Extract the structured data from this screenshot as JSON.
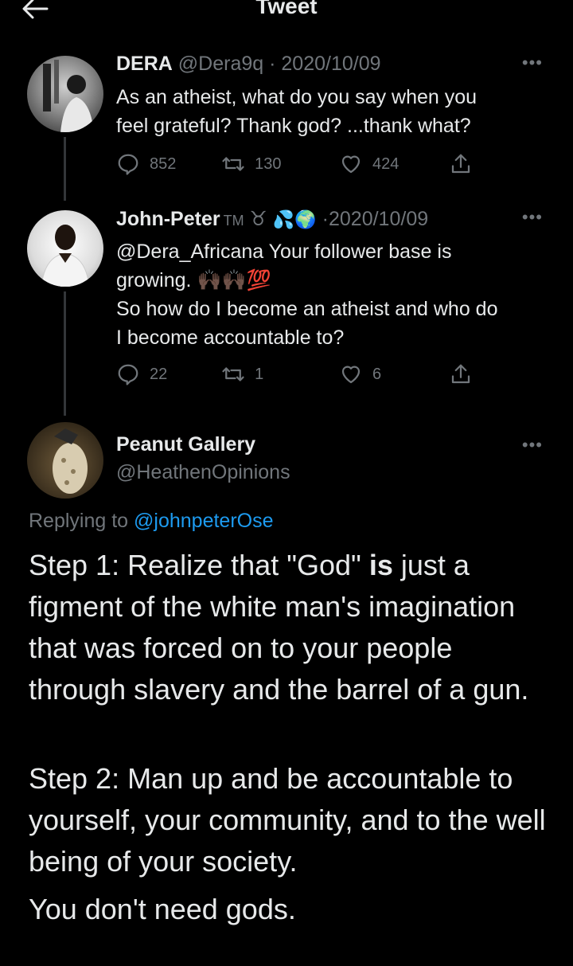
{
  "header": {
    "title": "Tweet"
  },
  "thread": [
    {
      "name": "DERA",
      "handle": "@Dera9q",
      "date": "2020/10/09",
      "sep": "·",
      "text_line1": "As an atheist, what do you say when you",
      "text_line2": "feel grateful? Thank god? ...thank what?",
      "replies": "852",
      "retweets": "130",
      "likes": "424"
    },
    {
      "name": "John-Peter",
      "badge": "TM",
      "symbol": "♉",
      "emojis": "💦🌍",
      "date": "2020/10/09",
      "sep": "·",
      "mention": "@Dera_Africana",
      "text_line1_rest": " Your follower base is",
      "text_line2": "growing. 🙌🏿🙌🏿💯",
      "text_line3": "So how do I become an atheist and who do",
      "text_line4": "I become accountable to?",
      "replies": "22",
      "retweets": "1",
      "likes": "6"
    }
  ],
  "main_tweet": {
    "name": "Peanut Gallery",
    "handle": "@HeathenOpinions",
    "replying_label": "Replying to",
    "replying_handle": "@johnpeterOse",
    "p1_pre": "Step 1: Realize that \"God\" ",
    "p1_bold": "is",
    "p1_post": " just a figment of the white man's imagination that was forced on to your people through slavery and the barrel of a gun.",
    "p2": "Step 2: Man up and be accountable to yourself, your community, and to the well being of your society.",
    "p3": "You don't need gods."
  },
  "icons": [
    "back-arrow-icon",
    "more-icon",
    "reply-icon",
    "retweet-icon",
    "like-icon",
    "share-icon"
  ],
  "colors": {
    "background": "#000000",
    "text": "#e7e9ea",
    "muted": "#71767b",
    "link": "#1d9bf0",
    "thread_line": "#333639"
  }
}
